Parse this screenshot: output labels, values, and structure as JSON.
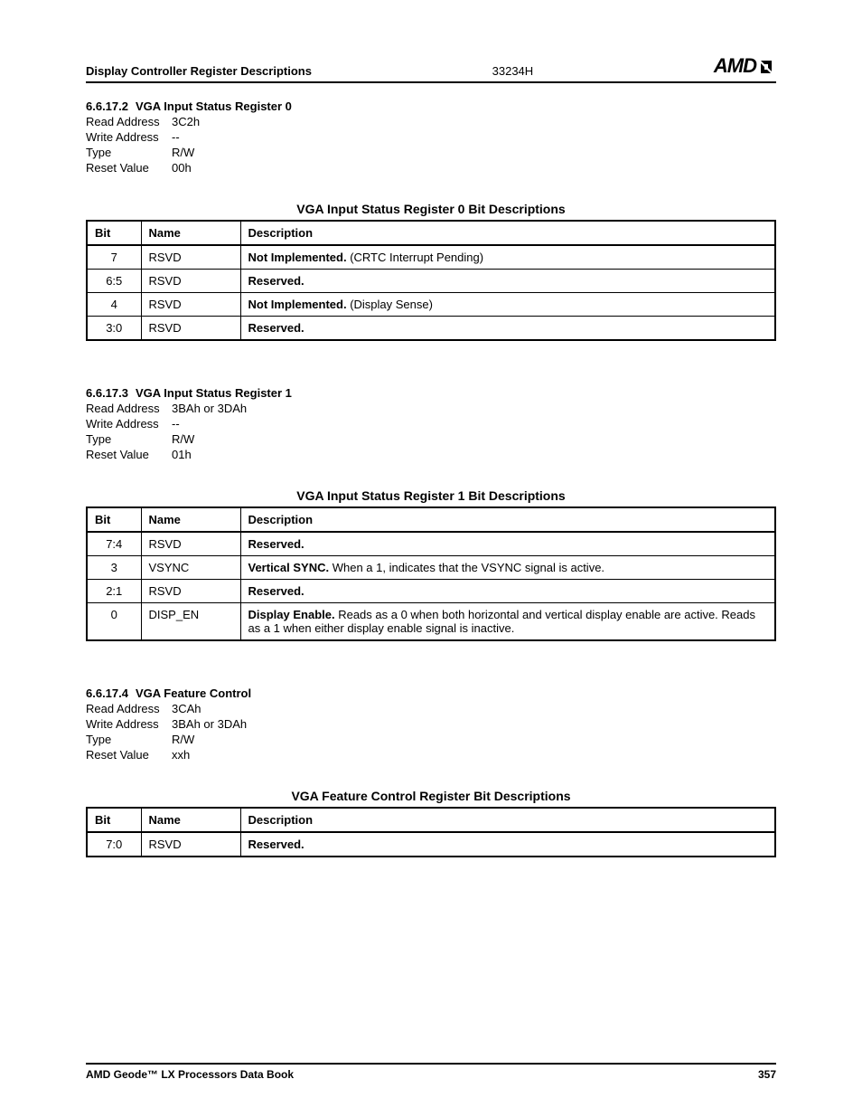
{
  "header": {
    "left": "Display Controller Register Descriptions",
    "mid": "33234H",
    "brand": "AMD"
  },
  "sections": [
    {
      "num": "6.6.17.2",
      "title": "VGA Input Status Register 0",
      "props": {
        "read_address_label": "Read Address",
        "read_address_value": "3C2h",
        "write_address_label": "Write Address",
        "write_address_value": "--",
        "type_label": "Type",
        "type_value": "R/W",
        "reset_label": "Reset Value",
        "reset_value": "00h"
      },
      "table_title": "VGA Input Status Register 0 Bit Descriptions",
      "col_bit": "Bit",
      "col_name": "Name",
      "col_desc": "Description",
      "rows": [
        {
          "bit": "7",
          "name": "RSVD",
          "desc_bold": "Not Implemented.",
          "desc_rest": " (CRTC Interrupt Pending)"
        },
        {
          "bit": "6:5",
          "name": "RSVD",
          "desc_bold": "Reserved.",
          "desc_rest": ""
        },
        {
          "bit": "4",
          "name": "RSVD",
          "desc_bold": "Not Implemented.",
          "desc_rest": " (Display Sense)"
        },
        {
          "bit": "3:0",
          "name": "RSVD",
          "desc_bold": "Reserved.",
          "desc_rest": ""
        }
      ]
    },
    {
      "num": "6.6.17.3",
      "title": "VGA Input Status Register 1",
      "props": {
        "read_address_label": "Read Address",
        "read_address_value": "3BAh or 3DAh",
        "write_address_label": "Write Address",
        "write_address_value": "--",
        "type_label": "Type",
        "type_value": "R/W",
        "reset_label": "Reset Value",
        "reset_value": "01h"
      },
      "table_title": "VGA Input Status Register 1 Bit Descriptions",
      "col_bit": "Bit",
      "col_name": "Name",
      "col_desc": "Description",
      "rows": [
        {
          "bit": "7:4",
          "name": "RSVD",
          "desc_bold": "Reserved.",
          "desc_rest": ""
        },
        {
          "bit": "3",
          "name": "VSYNC",
          "desc_bold": "Vertical SYNC.",
          "desc_rest": " When a 1, indicates that the VSYNC signal is active."
        },
        {
          "bit": "2:1",
          "name": "RSVD",
          "desc_bold": "Reserved.",
          "desc_rest": ""
        },
        {
          "bit": "0",
          "name": "DISP_EN",
          "desc_bold": "Display Enable.",
          "desc_rest": " Reads as a 0 when both horizontal and vertical display enable are active. Reads as a 1 when either display enable signal is inactive."
        }
      ]
    },
    {
      "num": "6.6.17.4",
      "title": "VGA Feature Control",
      "props": {
        "read_address_label": "Read Address",
        "read_address_value": "3CAh",
        "write_address_label": "Write Address",
        "write_address_value": "3BAh or 3DAh",
        "type_label": "Type",
        "type_value": "R/W",
        "reset_label": "Reset Value",
        "reset_value": "xxh"
      },
      "table_title": "VGA Feature Control Register Bit Descriptions",
      "col_bit": "Bit",
      "col_name": "Name",
      "col_desc": "Description",
      "rows": [
        {
          "bit": "7:0",
          "name": "RSVD",
          "desc_bold": "Reserved.",
          "desc_rest": ""
        }
      ]
    }
  ],
  "footer": {
    "left": "AMD Geode™ LX Processors Data Book",
    "right": "357"
  }
}
